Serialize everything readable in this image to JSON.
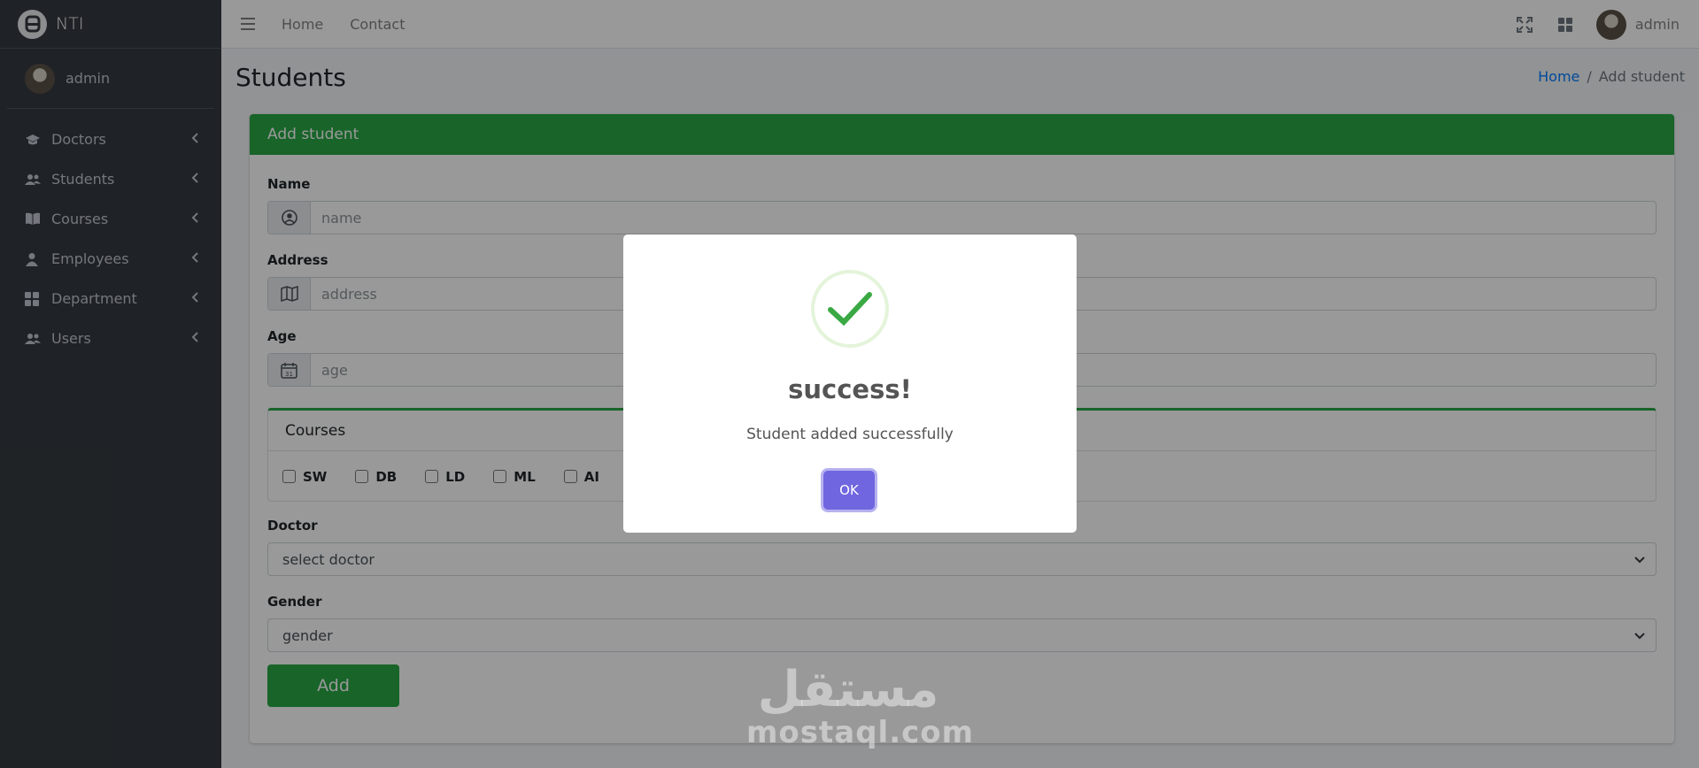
{
  "brand": {
    "name": "NTI",
    "logo_icon": "brand-logo-icon"
  },
  "sidebar": {
    "user": "admin",
    "items": [
      {
        "label": "Doctors",
        "icon": "graduation-cap-icon"
      },
      {
        "label": "Students",
        "icon": "users-icon"
      },
      {
        "label": "Courses",
        "icon": "book-icon"
      },
      {
        "label": "Employees",
        "icon": "user-icon"
      },
      {
        "label": "Department",
        "icon": "grid-icon"
      },
      {
        "label": "Users",
        "icon": "users-icon"
      }
    ]
  },
  "navbar": {
    "links": [
      "Home",
      "Contact"
    ],
    "user": "admin",
    "icons": [
      "menu-icon",
      "fullscreen-icon",
      "apps-grid-icon"
    ]
  },
  "page": {
    "title": "Students",
    "breadcrumb": {
      "home": "Home",
      "separator": "/",
      "current": "Add student"
    }
  },
  "form": {
    "header": "Add student",
    "name": {
      "label": "Name",
      "placeholder": "name",
      "icon": "user-circle-icon"
    },
    "address": {
      "label": "Address",
      "placeholder": "address",
      "icon": "map-icon"
    },
    "age": {
      "label": "Age",
      "placeholder": "age",
      "icon": "calendar-icon"
    },
    "courses": {
      "title": "Courses",
      "options": [
        "SW",
        "DB",
        "LD",
        "ML",
        "AI"
      ]
    },
    "doctor": {
      "label": "Doctor",
      "selected": "select doctor"
    },
    "gender": {
      "label": "Gender",
      "selected": "gender"
    },
    "submit_label": "Add"
  },
  "modal": {
    "title": "success!",
    "text": "Student added successfully",
    "ok_label": "OK",
    "icon": "success-check-icon"
  },
  "watermark": {
    "arabic": "مستقل",
    "latin": "mostaql.com"
  },
  "colors": {
    "sidebar_bg": "#343a40",
    "accent_green": "#28a745",
    "ok_button": "#7066e0",
    "link_blue": "#007bff"
  }
}
